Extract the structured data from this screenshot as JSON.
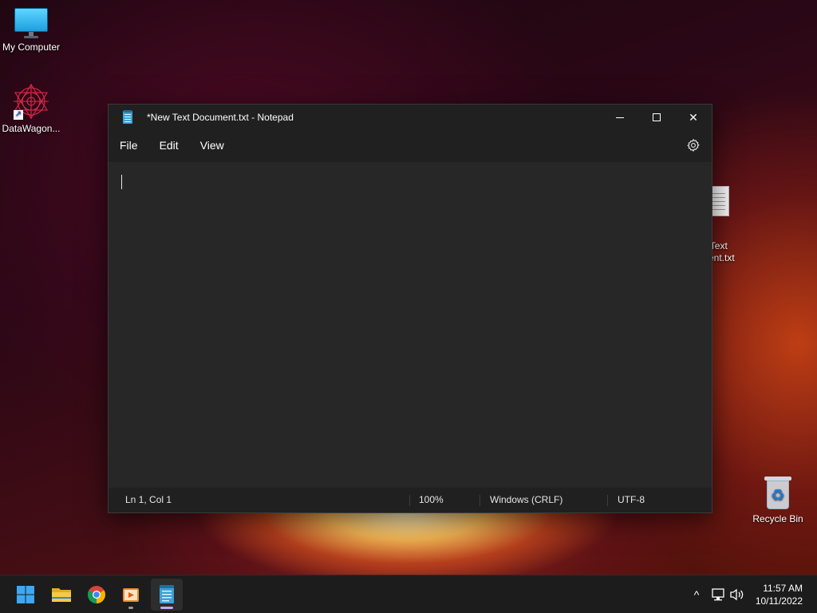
{
  "desktop": {
    "icons": [
      {
        "label": "My Computer",
        "icon": "computer-icon"
      },
      {
        "label": "DataWagon...",
        "icon": "fractal-shortcut-icon"
      },
      {
        "label": "w Text\nment.txt",
        "icon": "text-file-icon"
      },
      {
        "label": "Recycle Bin",
        "icon": "recycle-bin-icon"
      }
    ]
  },
  "window": {
    "title": "*New Text Document.txt - Notepad",
    "controls": {
      "minimize": "minimize-icon",
      "maximize": "maximize-icon",
      "close": "close-icon"
    },
    "menu": [
      "File",
      "Edit",
      "View"
    ],
    "settings_icon": "gear-icon",
    "editor_text": "",
    "status": {
      "position": "Ln 1, Col 1",
      "zoom": "100%",
      "line_ending": "Windows (CRLF)",
      "encoding": "UTF-8"
    }
  },
  "taskbar": {
    "apps": [
      {
        "name": "Start",
        "icon": "windows-start-icon"
      },
      {
        "name": "File Explorer",
        "icon": "folder-icon"
      },
      {
        "name": "Google Chrome",
        "icon": "chrome-icon"
      },
      {
        "name": "Media Player",
        "icon": "media-player-icon"
      },
      {
        "name": "Notepad",
        "icon": "notepad-icon",
        "active": true
      }
    ],
    "tray_icons": [
      "chevron-up-icon",
      "network-icon",
      "volume-icon"
    ],
    "time": "11:57 AM",
    "date": "10/11/2022"
  },
  "colors": {
    "notepad_accent": "#3ea1d6",
    "active_indicator": "#c9a6f2",
    "chrome_red": "#db4437",
    "chrome_green": "#0f9d58",
    "chrome_yellow": "#f4b400",
    "chrome_blue": "#4285f4"
  }
}
